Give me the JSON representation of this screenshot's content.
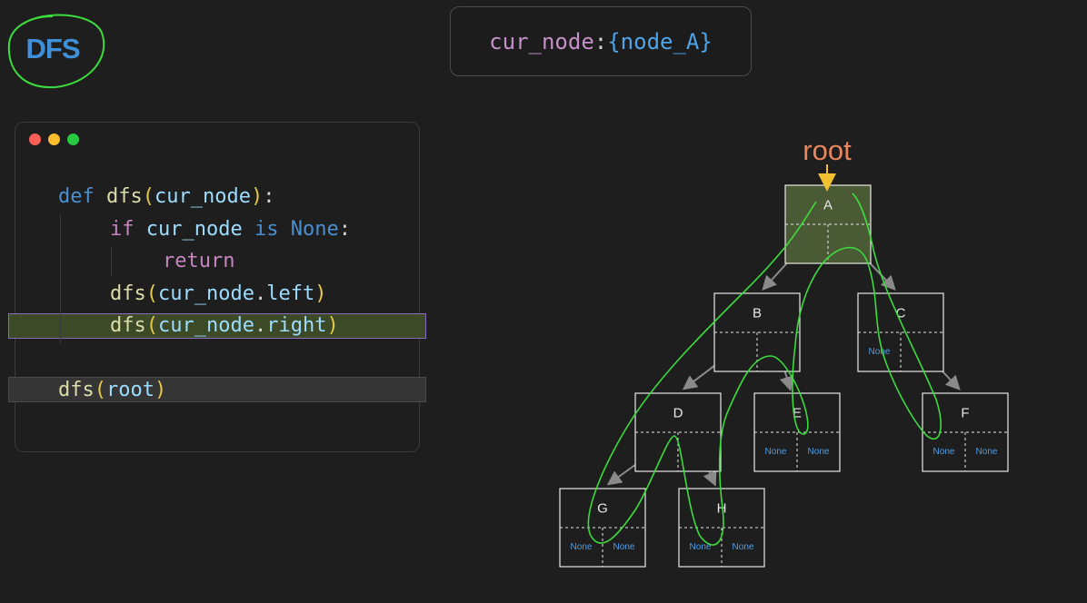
{
  "logo": {
    "text": "DFS"
  },
  "state": {
    "variable": "cur_node",
    "separator": ":",
    "value": "{node_A}"
  },
  "code": {
    "window_dots": [
      "red",
      "yellow",
      "green"
    ],
    "current_line_index": 4,
    "call_line_index": 5
  },
  "tree": {
    "root_label": "root",
    "none_text": "None",
    "nodes": [
      {
        "id": "A",
        "label": "A",
        "highlighted": true,
        "left_none": false,
        "right_none": false
      },
      {
        "id": "B",
        "label": "B",
        "highlighted": false,
        "left_none": false,
        "right_none": false
      },
      {
        "id": "C",
        "label": "C",
        "highlighted": false,
        "left_none": true,
        "right_none": false
      },
      {
        "id": "D",
        "label": "D",
        "highlighted": false,
        "left_none": false,
        "right_none": false
      },
      {
        "id": "E",
        "label": "E",
        "highlighted": false,
        "left_none": true,
        "right_none": true
      },
      {
        "id": "F",
        "label": "F",
        "highlighted": false,
        "left_none": true,
        "right_none": true
      },
      {
        "id": "G",
        "label": "G",
        "highlighted": false,
        "left_none": true,
        "right_none": true
      },
      {
        "id": "H",
        "label": "H",
        "highlighted": false,
        "left_none": true,
        "right_none": true
      }
    ],
    "edges": [
      {
        "from": "A",
        "to": "B",
        "side": "left"
      },
      {
        "from": "A",
        "to": "C",
        "side": "right"
      },
      {
        "from": "B",
        "to": "D",
        "side": "left"
      },
      {
        "from": "B",
        "to": "E",
        "side": "right"
      },
      {
        "from": "C",
        "to": "F",
        "side": "right"
      },
      {
        "from": "D",
        "to": "G",
        "side": "left"
      },
      {
        "from": "D",
        "to": "H",
        "side": "right"
      }
    ]
  },
  "colors": {
    "background": "#1e1e1e",
    "highlight_node": "#4a5a35",
    "annotation_stroke": "#3ddc3d",
    "root_label": "#e8855a",
    "root_arrow": "#f0c030",
    "none_text": "#4f9ee8"
  }
}
